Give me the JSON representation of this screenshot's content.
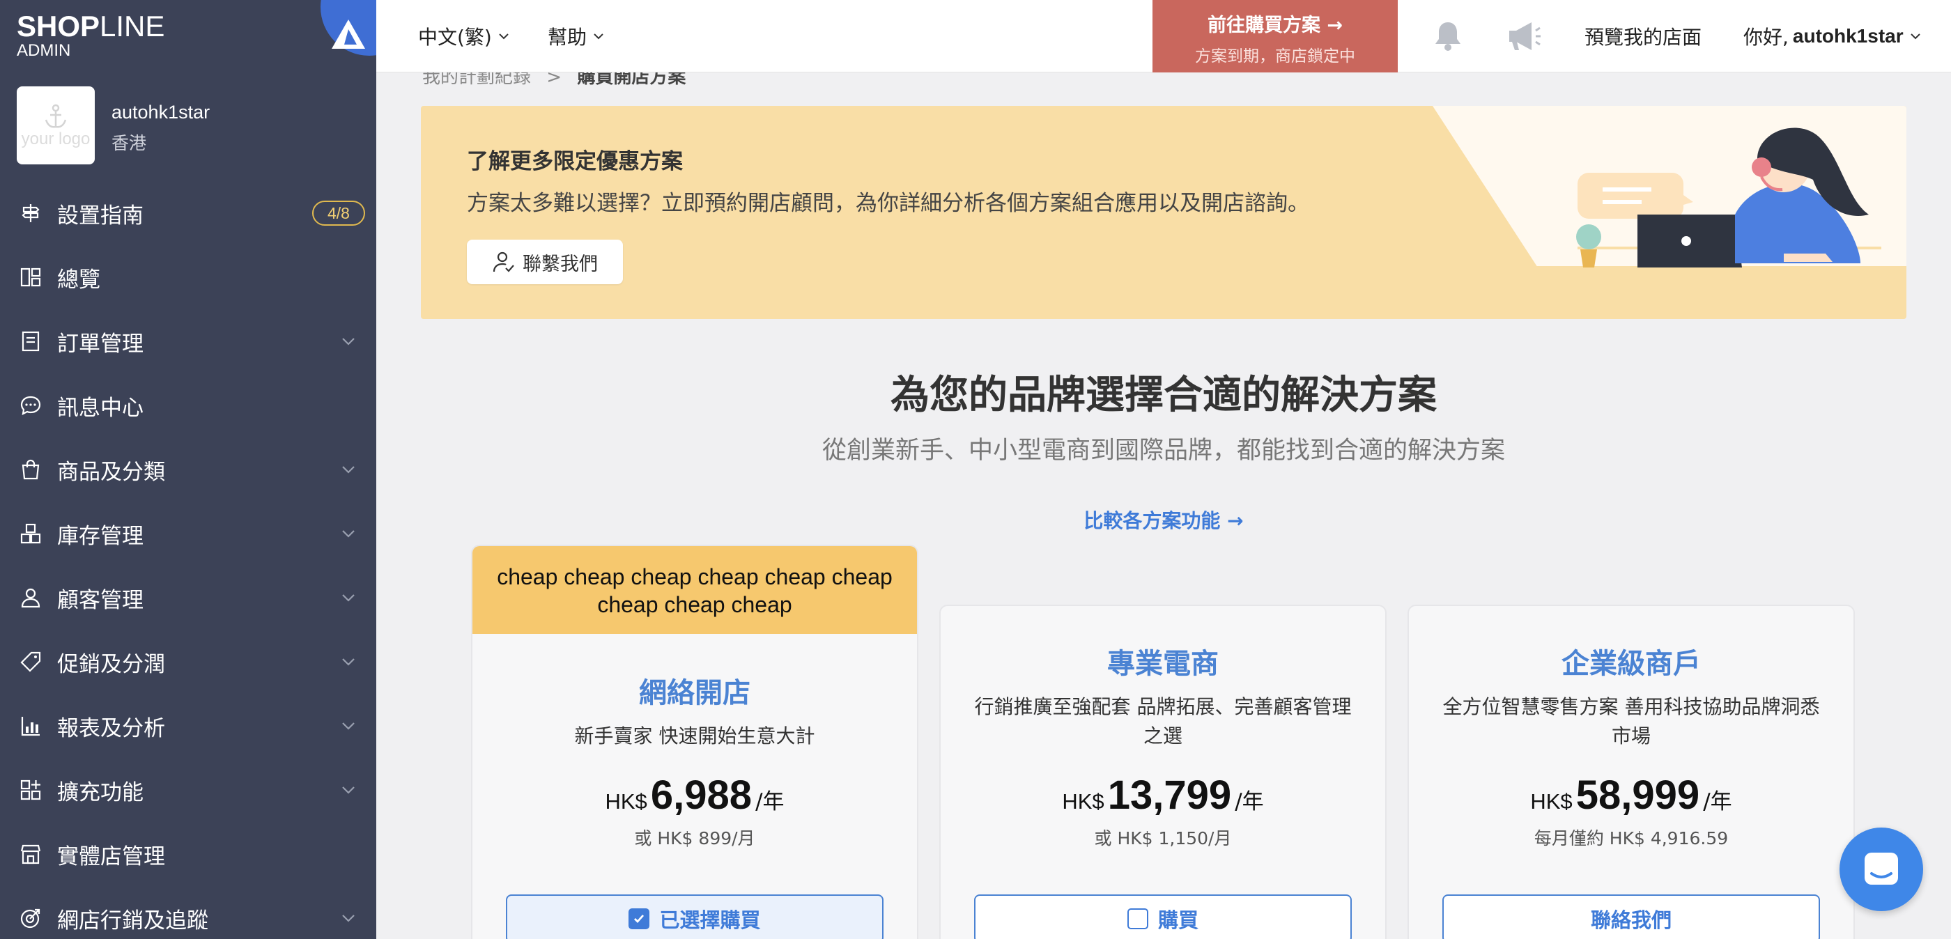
{
  "brand": {
    "logo_bold": "SHOP",
    "logo_light": "LINE",
    "admin": "ADMIN"
  },
  "store": {
    "name": "autohk1star",
    "region": "香港",
    "logo_text": "your logo"
  },
  "sidebar": {
    "items": [
      {
        "label": "設置指南",
        "badge": "4/8",
        "icon": "guide-icon"
      },
      {
        "label": "總覽",
        "icon": "dashboard-icon"
      },
      {
        "label": "訂單管理",
        "icon": "order-icon",
        "expandable": true
      },
      {
        "label": "訊息中心",
        "icon": "message-icon"
      },
      {
        "label": "商品及分類",
        "icon": "shopping-bag-icon",
        "expandable": true
      },
      {
        "label": "庫存管理",
        "icon": "inventory-icon",
        "expandable": true
      },
      {
        "label": "顧客管理",
        "icon": "customer-icon",
        "expandable": true
      },
      {
        "label": "促銷及分潤",
        "icon": "tag-icon",
        "expandable": true
      },
      {
        "label": "報表及分析",
        "icon": "chart-icon",
        "expandable": true
      },
      {
        "label": "擴充功能",
        "icon": "apps-icon",
        "expandable": true
      },
      {
        "label": "實體店管理",
        "icon": "store-icon"
      },
      {
        "label": "網店行銷及追蹤",
        "icon": "marketing-icon",
        "expandable": true
      }
    ]
  },
  "header": {
    "language": "中文(繁)",
    "help": "幫助",
    "buy_plan_title": "前往購買方案 →",
    "buy_plan_sub": "方案到期，商店鎖定中",
    "preview": "預覽我的店面",
    "greeting": "你好,",
    "username": "autohk1star"
  },
  "breadcrumb": {
    "parent": "我的計劃紀錄",
    "separator": ">",
    "current": "購買開店方案"
  },
  "promo": {
    "title": "了解更多限定優惠方案",
    "description": "方案太多難以選擇？立即預約開店顧問，為你詳細分析各個方案組合應用以及開店諮詢。",
    "button": "聯繫我們"
  },
  "main": {
    "heading": "為您的品牌選擇合適的解決方案",
    "subheading": "從創業新手、中小型電商到國際品牌，都能找到合適的解決方案",
    "compare_link": "比較各方案功能 →"
  },
  "plans": [
    {
      "ribbon": "cheap cheap cheap cheap cheap cheap cheap cheap cheap",
      "name": "網絡開店",
      "description": "新手賣家 快速開始生意大計",
      "currency": "HK$",
      "price": "6,988",
      "unit": "/年",
      "sub": "或 HK$ 899/月",
      "button": "已選擇購買",
      "selected": true
    },
    {
      "name": "專業電商",
      "description": "行銷推廣至強配套 品牌拓展、完善顧客管理之選",
      "currency": "HK$",
      "price": "13,799",
      "unit": "/年",
      "sub": "或 HK$ 1,150/月",
      "button": "購買",
      "selected": false
    },
    {
      "name": "企業級商戶",
      "description": "全方位智慧零售方案 善用科技協助品牌洞悉市場",
      "currency": "HK$",
      "price": "58,999",
      "unit": "/年",
      "sub": "每月僅約 HK$ 4,916.59",
      "button": "聯絡我們"
    }
  ],
  "colors": {
    "sidebar": "#3c4257",
    "accent": "#4b83d3",
    "promo_bg": "#f9dea6",
    "buy_plan_bg": "#c9675d",
    "ribbon": "#f6c86e"
  }
}
